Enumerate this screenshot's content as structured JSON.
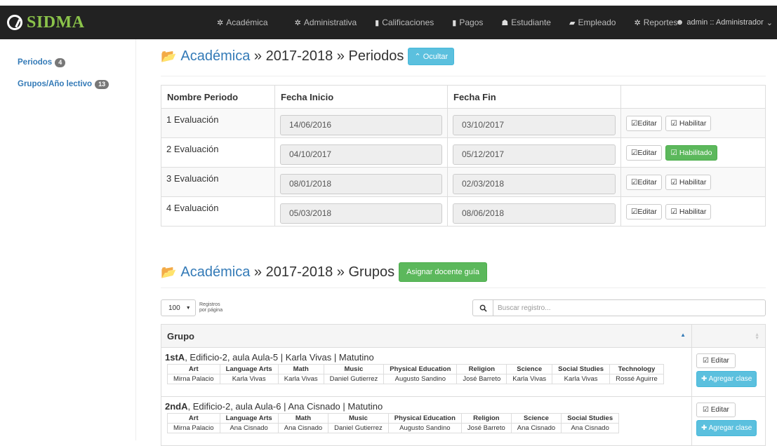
{
  "brand": {
    "name": "SIDMA"
  },
  "nav": {
    "items": [
      {
        "label": "Académica",
        "icon": "gear-icon",
        "glyph": "✲"
      },
      {
        "label": "Administrativa",
        "icon": "gear-icon",
        "glyph": "✲"
      },
      {
        "label": "Calificaciones",
        "icon": "file-icon",
        "glyph": "▮"
      },
      {
        "label": "Pagos",
        "icon": "file-icon",
        "glyph": "▮"
      },
      {
        "label": "Estudiante",
        "icon": "graduation-cap-icon",
        "glyph": "☗"
      },
      {
        "label": "Empleado",
        "icon": "folder-open-icon",
        "glyph": "▰"
      },
      {
        "label": "Reportes",
        "icon": "gear-icon",
        "glyph": "✲"
      }
    ],
    "user": "admin :: Administrador"
  },
  "sidebar": {
    "items": [
      {
        "label": "Periodos",
        "badge": "4"
      },
      {
        "label": "Grupos/Año lectivo",
        "badge": "13"
      }
    ]
  },
  "periods": {
    "heading": {
      "link": "Académica",
      "rest": " » 2017-2018 » Periodos"
    },
    "toggle_label": "Ocultar",
    "columns": [
      "Nombre Periodo",
      "Fecha Inicio",
      "Fecha Fin",
      ""
    ],
    "rows": [
      {
        "name": "1 Evaluación",
        "start": "14/06/2016",
        "end": "03/10/2017",
        "edit": "Editar",
        "action": "Habilitar",
        "enabled": false
      },
      {
        "name": "2 Evaluación",
        "start": "04/10/2017",
        "end": "05/12/2017",
        "edit": "Editar",
        "action": "Habilitado",
        "enabled": true
      },
      {
        "name": "3 Evaluación",
        "start": "08/01/2018",
        "end": "02/03/2018",
        "edit": "Editar",
        "action": "Habilitar",
        "enabled": false
      },
      {
        "name": "4 Evaluación",
        "start": "05/03/2018",
        "end": "08/06/2018",
        "edit": "Editar",
        "action": "Habilitar",
        "enabled": false
      }
    ]
  },
  "groups": {
    "heading": {
      "link": "Académica",
      "rest": " » 2017-2018 » Grupos"
    },
    "assign_label": "Asignar docente guía",
    "page_size": "100",
    "page_size_label": "Registros por página",
    "search_placeholder": "Buscar registro...",
    "column": "Grupo",
    "edit_label": "Editar",
    "add_label": "Agregar clase",
    "rows": [
      {
        "code": "1stA",
        "detail": ", Edificio-2, aula Aula-5 | Karla Vivas | Matutino",
        "subjects": [
          {
            "s": "Art",
            "t": "Mirna Palacio"
          },
          {
            "s": "Language Arts",
            "t": "Karla Vivas"
          },
          {
            "s": "Math",
            "t": "Karla Vivas"
          },
          {
            "s": "Music",
            "t": "Daniel Gutierrez"
          },
          {
            "s": "Physical Education",
            "t": "Augusto Sandino"
          },
          {
            "s": "Religion",
            "t": "José Barreto"
          },
          {
            "s": "Science",
            "t": "Karla Vivas"
          },
          {
            "s": "Social Studies",
            "t": "Karla Vivas"
          },
          {
            "s": "Technology",
            "t": "Rossé Aguirre"
          }
        ]
      },
      {
        "code": "2ndA",
        "detail": ", Edificio-2, aula Aula-6 | Ana Cisnado | Matutino",
        "subjects": [
          {
            "s": "Art",
            "t": "Mirna Palacio"
          },
          {
            "s": "Language Arts",
            "t": "Ana Cisnado"
          },
          {
            "s": "Math",
            "t": "Ana Cisnado"
          },
          {
            "s": "Music",
            "t": "Daniel Gutierrez"
          },
          {
            "s": "Physical Education",
            "t": "Augusto Sandino"
          },
          {
            "s": "Religion",
            "t": "José Barreto"
          },
          {
            "s": "Science",
            "t": "Ana Cisnado"
          },
          {
            "s": "Social Studies",
            "t": "Ana Cisnado"
          }
        ]
      }
    ]
  },
  "colors": {
    "navbar": "#222222",
    "brand": "#8bc34a",
    "link": "#337ab7",
    "success": "#5cb85c",
    "info": "#5bc0de"
  }
}
